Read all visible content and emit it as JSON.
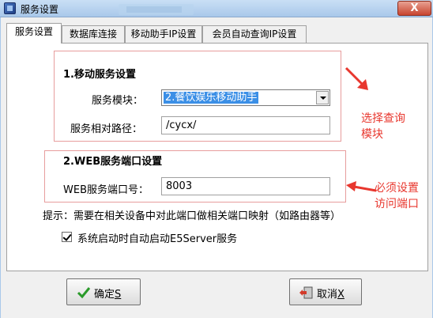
{
  "window": {
    "title": "服务设置",
    "close_label": "X"
  },
  "tabs": [
    {
      "label": "服务设置",
      "active": true
    },
    {
      "label": "数据库连接",
      "active": false
    },
    {
      "label": "移动助手IP设置",
      "active": false
    },
    {
      "label": "会员自动查询IP设置",
      "active": false
    }
  ],
  "section1": {
    "title": "1.移动服务设置",
    "module_label": "服务模块：",
    "module_value": "2.餐饮娱乐移动助手",
    "path_label": "服务相对路径：",
    "path_value": "/cycx/"
  },
  "section2": {
    "title": "2.WEB服务端口设置",
    "port_label": "WEB服务端口号：",
    "port_value": "8003"
  },
  "hint": "提示：需要在相关设备中对此端口做相关端口映射（如路由器等）",
  "checkbox": {
    "label": "系统启动时自动启动E5Server服务",
    "checked": true
  },
  "annotations": {
    "choose_query_line1": "选择查询",
    "choose_query_line2": "模块",
    "must_set_line1": "必须设置",
    "must_set_line2": "访问端口"
  },
  "buttons": {
    "ok_label": "确定",
    "ok_accel": "S",
    "cancel_label": "取消",
    "cancel_accel": "X"
  },
  "colors": {
    "annotation": "#e8372e",
    "selection": "#3b8fe6"
  }
}
